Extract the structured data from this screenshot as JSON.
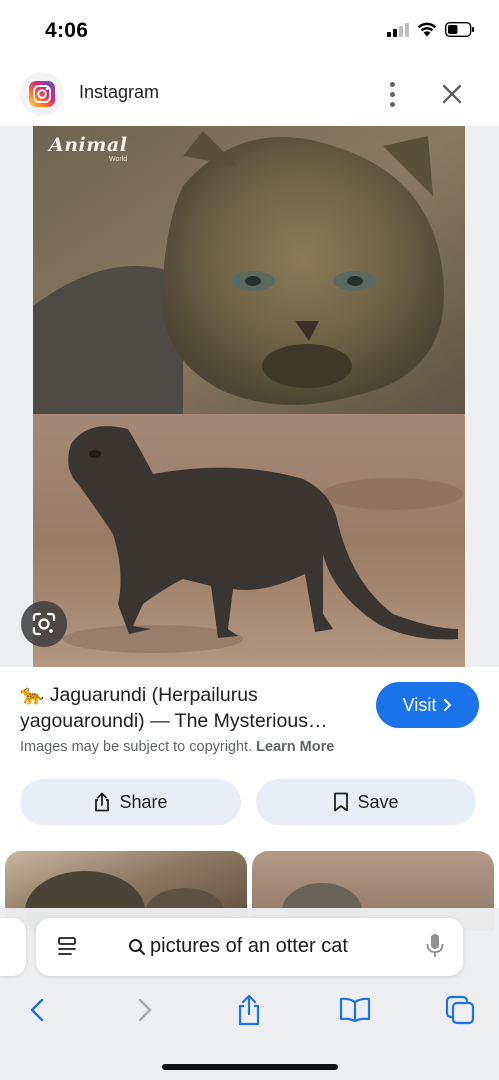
{
  "status_bar": {
    "time": "4:06",
    "battery_level": 0.45
  },
  "header": {
    "title": "Instagram",
    "icon": "instagram-logo-icon"
  },
  "image": {
    "caption": "Animal",
    "subcaption": "World"
  },
  "result": {
    "title_line1": "🐆 Jaguarundi (Herpailurus",
    "title_line2": "yagouaroundi) — The Mysterious…",
    "visit_label": "Visit",
    "copyright_text": "Images may be subject to copyright.",
    "learn_more": "Learn More"
  },
  "actions": {
    "share_label": "Share",
    "save_label": "Save"
  },
  "browser": {
    "url_text": "pictures of an otter cat"
  },
  "colors": {
    "accent": "#1a73e8",
    "action_bg": "#e8eef8"
  }
}
